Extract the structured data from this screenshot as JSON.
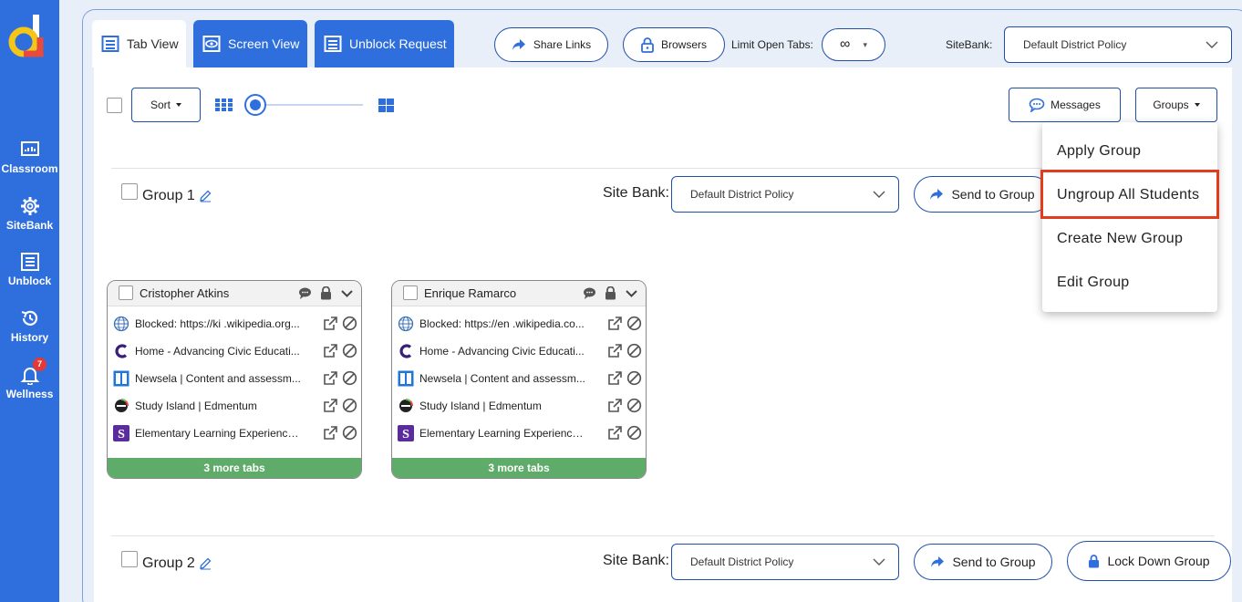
{
  "sidebar": {
    "items": [
      {
        "label": "Classroom",
        "icon": "classroom-icon"
      },
      {
        "label": "SiteBank",
        "icon": "gear-icon"
      },
      {
        "label": "Unblock",
        "icon": "list-icon"
      },
      {
        "label": "History",
        "icon": "history-icon"
      },
      {
        "label": "Wellness",
        "icon": "bell-icon",
        "badge": "7"
      }
    ]
  },
  "tabs": [
    {
      "label": "Tab View",
      "icon": "tab-view-icon",
      "active": true
    },
    {
      "label": "Screen View",
      "icon": "eye-icon"
    },
    {
      "label": "Unblock Request",
      "icon": "list-icon"
    }
  ],
  "toolbar": {
    "share_links": "Share Links",
    "browsers": "Browsers",
    "limit_label": "Limit Open Tabs:",
    "limit_value": "∞",
    "sitebank_label": "SiteBank:",
    "sitebank_value": "Default District Policy"
  },
  "controls": {
    "sort": "Sort",
    "messages": "Messages",
    "groups": "Groups",
    "zoom_level": 0
  },
  "groups_menu": {
    "items": [
      "Apply Group",
      "Ungroup All Students",
      "Create New Group",
      "Edit Group"
    ],
    "highlighted": "Ungroup All Students"
  },
  "groups": [
    {
      "name": "Group 1",
      "site_bank_label": "Site Bank:",
      "site_bank_value": "Default District Policy",
      "send_label": "Send to Group"
    },
    {
      "name": "Group 2",
      "site_bank_label": "Site Bank:",
      "site_bank_value": "Default District Policy",
      "send_label": "Send to Group",
      "lock_label": "Lock Down Group"
    }
  ],
  "students": [
    {
      "name": "Cristopher Atkins",
      "tabs": [
        {
          "title": "Blocked: https://ki .wikipedia.org...",
          "icon": "globe-icon"
        },
        {
          "title": "Home - Advancing Civic Educati...",
          "icon": "c-logo-icon"
        },
        {
          "title": "Newsela | Content and assessm...",
          "icon": "newsela-icon"
        },
        {
          "title": "Study Island | Edmentum",
          "icon": "edmentum-icon"
        },
        {
          "title": "Elementary Learning Experience ...",
          "icon": "s-logo-icon"
        }
      ],
      "more_tabs": "3 more tabs"
    },
    {
      "name": "Enrique Ramarco",
      "tabs": [
        {
          "title": "Blocked: https://en .wikipedia.co...",
          "icon": "globe-icon"
        },
        {
          "title": "Home - Advancing Civic Educati...",
          "icon": "c-logo-icon"
        },
        {
          "title": "Newsela | Content and assessm...",
          "icon": "newsela-icon"
        },
        {
          "title": "Study Island | Edmentum",
          "icon": "edmentum-icon"
        },
        {
          "title": "Elementary Learning Experience ...",
          "icon": "s-logo-icon"
        }
      ],
      "more_tabs": "3 more tabs"
    }
  ],
  "colors": {
    "sidebar": "#2f6fdd",
    "accent_border": "#1f4fa8",
    "more_tabs_bar": "#5fab6a",
    "highlight": "#e23b1e"
  }
}
